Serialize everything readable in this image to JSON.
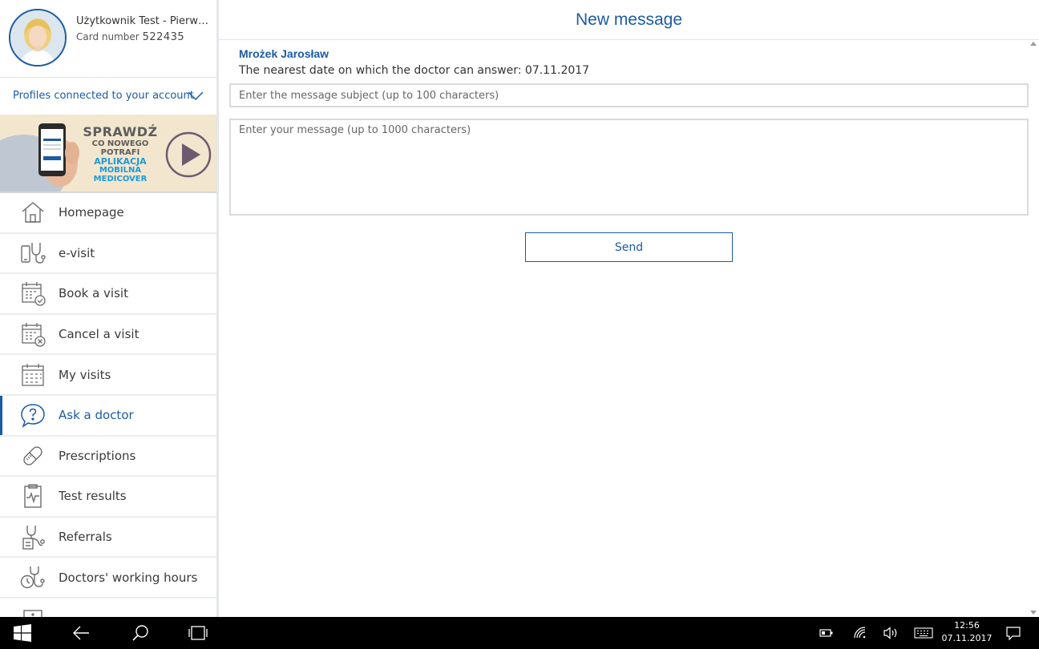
{
  "profile": {
    "name": "Użytkownik Test - Pierws...",
    "card_label": "Card number",
    "card_number": "522435"
  },
  "profiles_link": "Profiles connected to your account",
  "banner": {
    "line1": "SPRAWDŹ",
    "line2": "CO NOWEGO",
    "line3": "POTRAFI",
    "line4": "APLIKACJA",
    "line5": "MOBILNA",
    "line6": "MEDICOVER"
  },
  "nav": {
    "items": [
      {
        "label": "Homepage",
        "icon": "home-icon"
      },
      {
        "label": "e-visit",
        "icon": "phone-stethoscope-icon"
      },
      {
        "label": "Book a visit",
        "icon": "calendar-check-icon"
      },
      {
        "label": "Cancel a visit",
        "icon": "calendar-cancel-icon"
      },
      {
        "label": "My visits",
        "icon": "calendar-icon"
      },
      {
        "label": "Ask a doctor",
        "icon": "question-bubble-icon",
        "active": true
      },
      {
        "label": "Prescriptions",
        "icon": "pill-icon"
      },
      {
        "label": "Test results",
        "icon": "clipboard-pulse-icon"
      },
      {
        "label": "Referrals",
        "icon": "stethoscope-document-icon"
      },
      {
        "label": "Doctors' working hours",
        "icon": "stethoscope-clock-icon"
      }
    ]
  },
  "main": {
    "title": "New message",
    "doctor_name": "Mrożek Jarosław",
    "nearest_date": "The nearest date on which the doctor can answer: 07.11.2017",
    "subject_placeholder": "Enter the message subject (up to 100 characters)",
    "message_placeholder": "Enter your message (up to 1000 characters)",
    "send_label": "Send"
  },
  "taskbar": {
    "time": "12:56",
    "date": "07.11.2017"
  },
  "colors": {
    "accent": "#1b5ba5",
    "banner_blue": "#1e9ad6",
    "taskbar": "#000000"
  }
}
